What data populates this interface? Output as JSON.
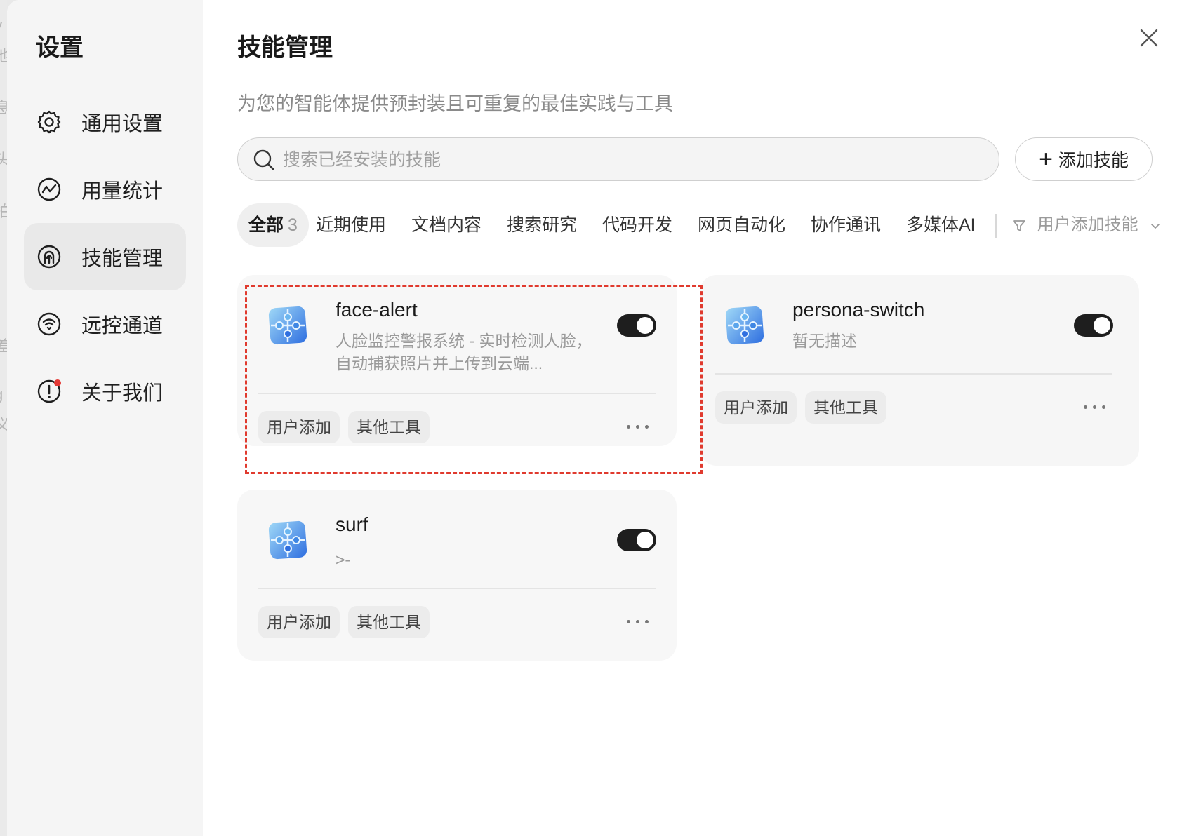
{
  "backdrop": {
    "fragments": [
      "y",
      "他",
      "息",
      "头",
      "拍",
      "-",
      "差",
      "g",
      "义"
    ]
  },
  "sidebar": {
    "title": "设置",
    "items": [
      {
        "label": "通用设置",
        "icon": "gear-icon"
      },
      {
        "label": "用量统计",
        "icon": "chart-icon"
      },
      {
        "label": "技能管理",
        "icon": "skill-icon",
        "active": true
      },
      {
        "label": "远控通道",
        "icon": "signal-icon"
      },
      {
        "label": "关于我们",
        "icon": "info-icon",
        "badge": true
      }
    ]
  },
  "main": {
    "title": "技能管理",
    "subtitle": "为您的智能体提供预封装且可重复的最佳实践与工具",
    "search": {
      "placeholder": "搜索已经安装的技能",
      "value": ""
    },
    "add_button": "添加技能",
    "tabs": [
      {
        "label": "全部",
        "count": "3",
        "active": true
      },
      {
        "label": "近期使用"
      },
      {
        "label": "文档内容"
      },
      {
        "label": "搜索研究"
      },
      {
        "label": "代码开发"
      },
      {
        "label": "网页自动化"
      },
      {
        "label": "协作通讯"
      },
      {
        "label": "多媒体AI"
      }
    ],
    "filter": {
      "label": "用户添加技能"
    },
    "skills": [
      {
        "name": "face-alert",
        "description": "人脸监控警报系统 - 实时检测人脸，自动捕获照片并上传到云端...",
        "enabled": true,
        "tags": [
          "用户添加",
          "其他工具"
        ]
      },
      {
        "name": "persona-switch",
        "description": "暂无描述",
        "enabled": true,
        "tags": [
          "用户添加",
          "其他工具"
        ]
      },
      {
        "name": "surf",
        "description": ">-",
        "enabled": true,
        "tags": [
          "用户添加",
          "其他工具"
        ]
      }
    ]
  },
  "colors": {
    "highlight": "#e03a2e",
    "toggle_on": "#1e1e1e",
    "badge": "#e53935"
  }
}
